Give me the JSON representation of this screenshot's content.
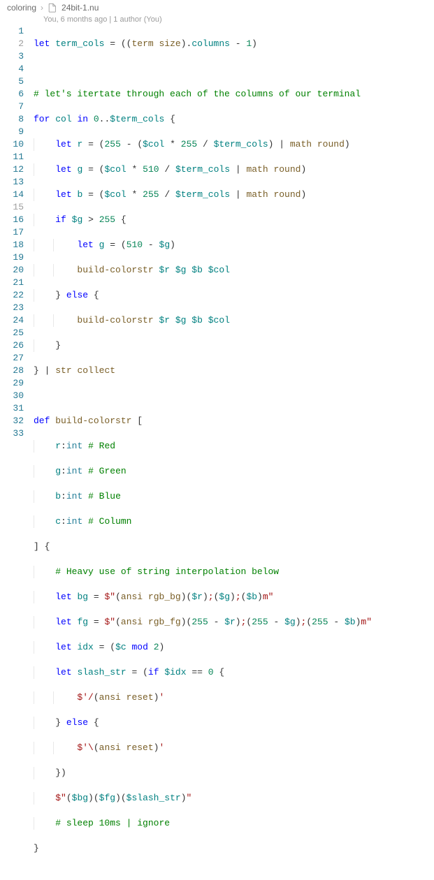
{
  "breadcrumb": {
    "folder": "coloring",
    "file": "24bit-1.nu"
  },
  "authors": "You, 6 months ago | 1 author (You)",
  "lines": {
    "count": 33
  },
  "code": {
    "l1": {
      "a": "let",
      "b": "term_cols",
      "c": "=",
      "d": "term size",
      "e": ".",
      "f": "columns",
      "g": "-",
      "h": "1"
    },
    "l3": "# let's itertate through each of the columns of our terminal",
    "l4": {
      "a": "for",
      "b": "col",
      "c": "in",
      "d": "0",
      "e": "..",
      "f": "$term_cols",
      "g": "{"
    },
    "l5": {
      "a": "let",
      "b": "r",
      "c": "=",
      "d": "255",
      "e": "-",
      "f": "$col",
      "g": "*",
      "h": "255",
      "i": "/",
      "j": "$term_cols",
      "k": "|",
      "l": "math round"
    },
    "l6": {
      "a": "let",
      "b": "g",
      "c": "=",
      "d": "$col",
      "e": "*",
      "f": "510",
      "g": "/",
      "h": "$term_cols",
      "i": "|",
      "j": "math round"
    },
    "l7": {
      "a": "let",
      "b": "b",
      "c": "=",
      "d": "$col",
      "e": "*",
      "f": "255",
      "g": "/",
      "h": "$term_cols",
      "i": "|",
      "j": "math round"
    },
    "l8": {
      "a": "if",
      "b": "$g",
      "c": ">",
      "d": "255",
      "e": "{"
    },
    "l9": {
      "a": "let",
      "b": "g",
      "c": "=",
      "d": "510",
      "e": "-",
      "f": "$g"
    },
    "l10": {
      "a": "build-colorstr",
      "b": "$r",
      "c": "$g",
      "d": "$b",
      "e": "$col"
    },
    "l11": {
      "a": "}",
      "b": "else",
      "c": "{"
    },
    "l12": {
      "a": "build-colorstr",
      "b": "$r",
      "c": "$g",
      "d": "$b",
      "e": "$col"
    },
    "l13": "}",
    "l14": {
      "a": "}",
      "b": "|",
      "c": "str collect"
    },
    "l16": {
      "a": "def",
      "b": "build-colorstr",
      "c": "["
    },
    "l17": {
      "a": "r",
      "b": ":",
      "c": "int",
      "d": "# Red"
    },
    "l18": {
      "a": "g",
      "b": ":",
      "c": "int",
      "d": "# Green"
    },
    "l19": {
      "a": "b",
      "b": ":",
      "c": "int",
      "d": "# Blue"
    },
    "l20": {
      "a": "c",
      "b": ":",
      "c": "int",
      "d": "# Column"
    },
    "l21": {
      "a": "]",
      "b": "{"
    },
    "l22": "# Heavy use of string interpolation below",
    "l23": {
      "a": "let",
      "b": "bg",
      "c": "=",
      "d": "$\"",
      "e": "ansi rgb_bg",
      "f": "$r",
      "g": ";",
      "h": "$g",
      "i": ";",
      "j": "$b",
      "k": "m\""
    },
    "l24": {
      "a": "let",
      "b": "fg",
      "c": "=",
      "d": "$\"",
      "e": "ansi rgb_fg",
      "f": "255",
      "g": "-",
      "h": "$r",
      "i": ";",
      "j": "255",
      "k": "-",
      "l": "$g",
      "m": ";",
      "n": "255",
      "o": "-",
      "p": "$b",
      "q": "m\""
    },
    "l25": {
      "a": "let",
      "b": "idx",
      "c": "=",
      "d": "$c",
      "e": "mod",
      "f": "2"
    },
    "l26": {
      "a": "let",
      "b": "slash_str",
      "c": "=",
      "d": "if",
      "e": "$idx",
      "f": "==",
      "g": "0",
      "h": "{"
    },
    "l27": {
      "a": "$'/",
      "b": "ansi reset",
      "c": "'"
    },
    "l28": {
      "a": "}",
      "b": "else",
      "c": "{"
    },
    "l29": {
      "a": "$'\\",
      "b": "ansi reset",
      "c": "'"
    },
    "l30": {
      "a": "}",
      "b": ")"
    },
    "l31": {
      "a": "$\"",
      "b": "$bg",
      "c": "$fg",
      "d": "$slash_str",
      "e": "\""
    },
    "l32": "# sleep 10ms | ignore",
    "l33": "}"
  }
}
